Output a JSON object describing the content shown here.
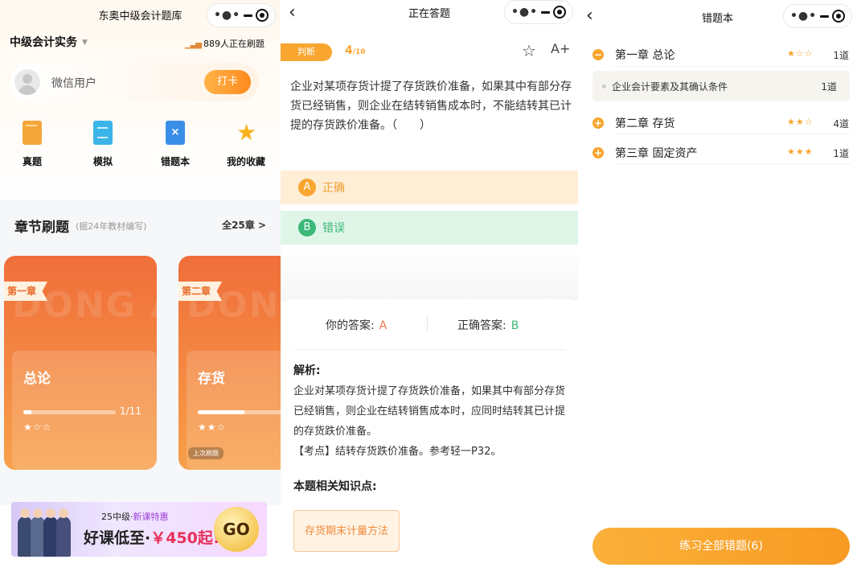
{
  "screen1": {
    "title": "东奥中级会计题库",
    "subject": "中级会计实务",
    "online_count": "889人正在刷题",
    "username": "微信用户",
    "checkin_label": "打卡",
    "quick_actions": [
      {
        "label": "真题",
        "icon": "book-icon"
      },
      {
        "label": "模拟",
        "icon": "document-icon"
      },
      {
        "label": "错题本",
        "icon": "error-book-icon"
      },
      {
        "label": "我的收藏",
        "icon": "star-icon"
      }
    ],
    "section_title": "章节刷题",
    "section_subtitle": "(据24年教材编写)",
    "section_more": "全25章 >",
    "watermark": "DONG AO DONG",
    "chapters": [
      {
        "tag": "第一章",
        "name": "总论",
        "progress_text": "1/11",
        "progress": 0.09,
        "stars": "★☆☆"
      },
      {
        "tag": "第二章",
        "name": "存货",
        "progress_text": "",
        "progress": 0.5,
        "stars": "★★☆",
        "last_badge": "上次刷题"
      }
    ],
    "banner": {
      "line1_prefix": "25中级·",
      "line1_highlight": "新课特惠",
      "line2_prefix": "好课低至·",
      "line2_highlight": "￥450起!",
      "go_label": "GO"
    }
  },
  "screen2": {
    "title": "正在答题",
    "type_tag": "判断",
    "current": "4",
    "total": "/10",
    "question": "企业对某项存货计提了存货跌价准备，如果其中有部分存货已经销售，则企业在结转销售成本时，不能结转其已计提的存货跌价准备。（　　）",
    "options": [
      {
        "letter": "A",
        "text": "正确"
      },
      {
        "letter": "B",
        "text": "错误"
      }
    ],
    "your_answer_label": "你的答案:",
    "your_answer": "A",
    "correct_answer_label": "正确答案:",
    "correct_answer": "B",
    "analysis_title": "解析:",
    "analysis_text": "企业对某项存货计提了存货跌价准备，如果其中有部分存货已经销售，则企业在结转销售成本时，应同时结转其已计提的存货跌价准备。",
    "analysis_note": "【考点】结转存货跌价准备。参考轻一P32。",
    "knowledge_title": "本题相关知识点:",
    "knowledge_tag": "存货期末计量方法"
  },
  "screen3": {
    "title": "错题本",
    "chapters": [
      {
        "name": "第一章 总论",
        "stars": "★☆☆",
        "count": "1道",
        "expanded": true
      },
      {
        "name": "第二章 存货",
        "stars": "★★☆",
        "count": "4道",
        "expanded": false
      },
      {
        "name": "第三章 固定资产",
        "stars": "★★★",
        "count": "1道",
        "expanded": false
      }
    ],
    "sub_item": {
      "name": "企业会计要素及其确认条件",
      "count": "1道"
    },
    "practice_button": "练习全部错题(6)"
  },
  "colors": {
    "accent": "#f8a630",
    "wrong": "#f4764a",
    "correct": "#3cb878"
  }
}
